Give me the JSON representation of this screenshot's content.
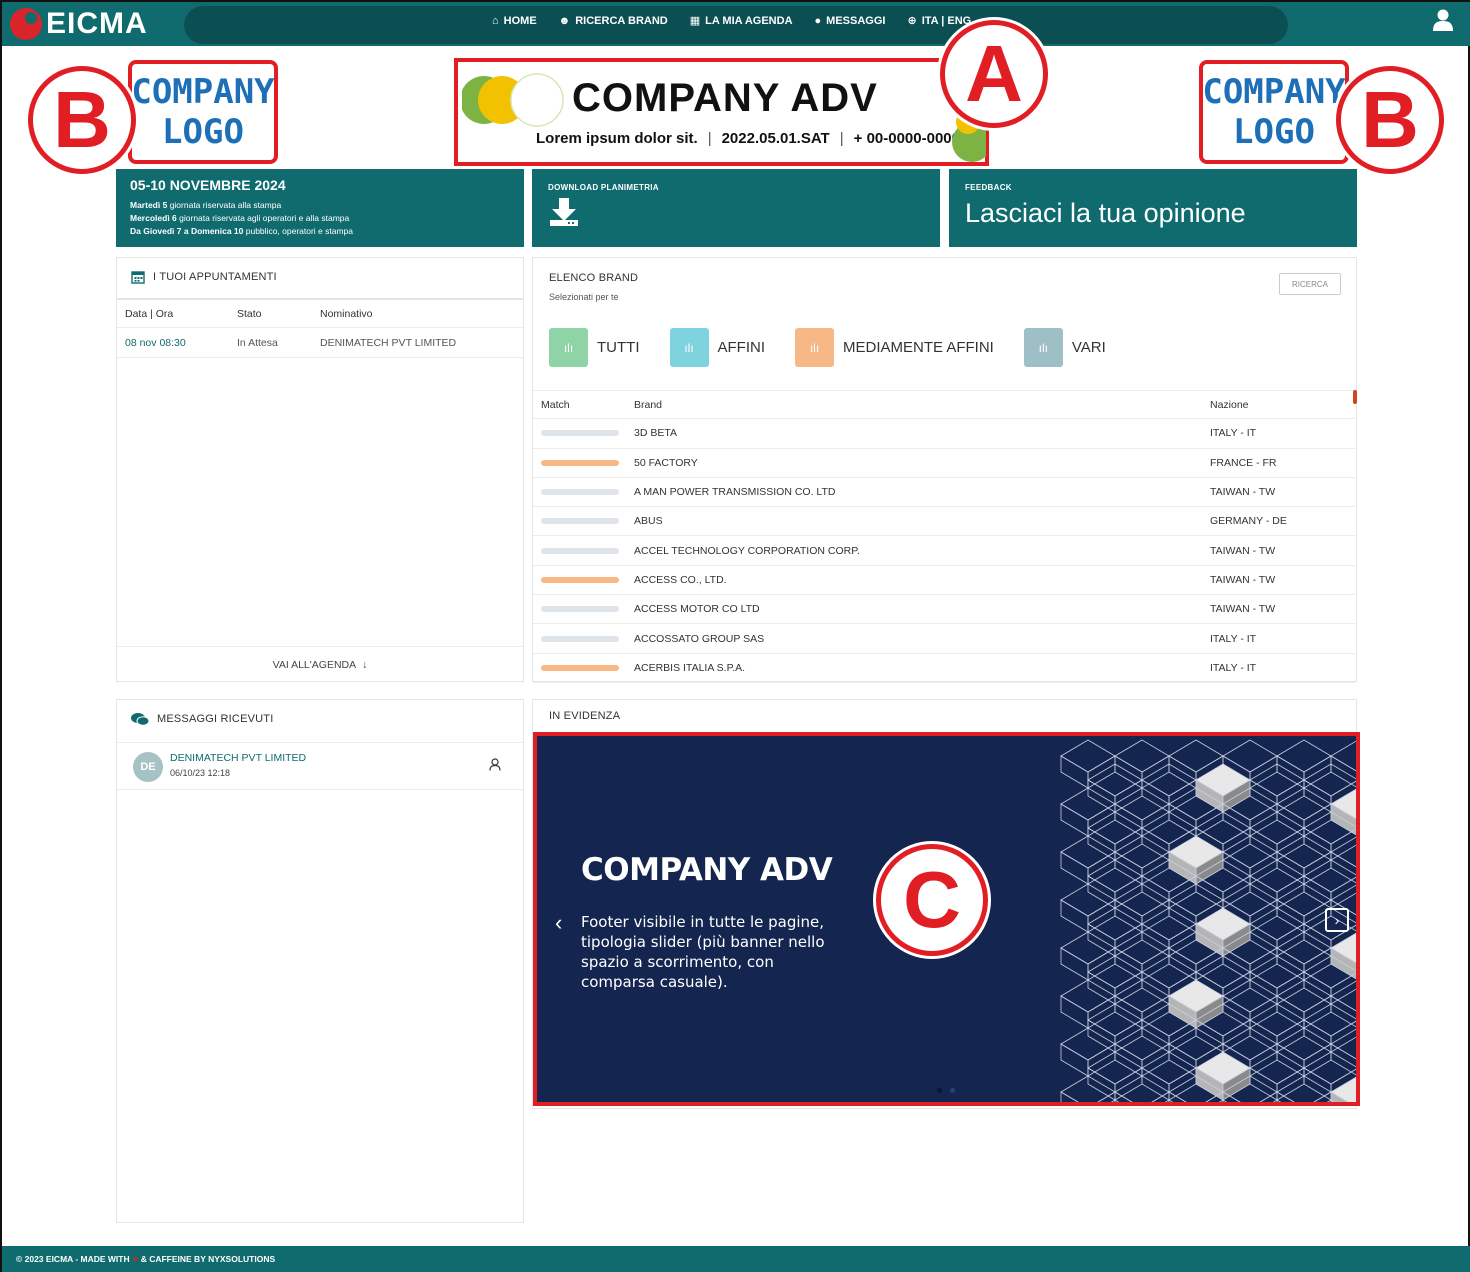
{
  "app": {
    "logo_text": "EICMA"
  },
  "nav": {
    "items": [
      {
        "label": "HOME",
        "icon": "home-icon"
      },
      {
        "label": "RICERCA BRAND",
        "icon": "users-icon"
      },
      {
        "label": "LA MIA AGENDA",
        "icon": "calendar-icon"
      },
      {
        "label": "MESSAGGI",
        "icon": "chat-icon"
      },
      {
        "label": "ITA | ENG",
        "icon": "globe-icon"
      }
    ]
  },
  "ad_top": {
    "title": "COMPANY ADV",
    "subtitle": "Lorem ipsum dolor sit.",
    "date": "2022.05.01.SAT",
    "phone": "+ 00-0000-0000",
    "sep": "|"
  },
  "badges": {
    "a": "A",
    "b": "B",
    "c": "C"
  },
  "company_logo": {
    "line1": "COMPANY",
    "line2": "LOGO"
  },
  "dates_block": {
    "title": "05-10 NOVEMBRE 2024",
    "lines": [
      {
        "bold": "Martedì 5",
        "text": " giornata riservata alla stampa"
      },
      {
        "bold": "Mercoledì 6",
        "text": " giornata  riservata agli operatori e alla stampa"
      },
      {
        "bold": "Da Giovedì 7 a Domenica 10",
        "text": " pubblico, operatori e stampa"
      }
    ]
  },
  "download_block": {
    "caption": "DOWNLOAD PLANIMETRIA"
  },
  "feedback_block": {
    "caption": "FEEDBACK",
    "text": "Lasciaci la tua opinione"
  },
  "appointments": {
    "title": "I TUOI APPUNTAMENTI",
    "headers": [
      "Data | Ora",
      "Stato",
      "Nominativo"
    ],
    "rows": [
      {
        "date": "08 nov 08:30",
        "status": "In Attesa",
        "name": "DENIMATECH PVT LIMITED"
      }
    ],
    "footer": "VAI ALL'AGENDA"
  },
  "brands": {
    "title": "ELENCO BRAND",
    "subtitle": "Selezionati per te",
    "search_label": "RICERCA",
    "filters": [
      {
        "label": "TUTTI",
        "color": "#8fd4a6"
      },
      {
        "label": "AFFINI",
        "color": "#7fd3de"
      },
      {
        "label": "MEDIAMENTE AFFINI",
        "color": "#f6b886"
      },
      {
        "label": "VARI",
        "color": "#9ebfc6"
      }
    ],
    "headers": [
      "Match",
      "Brand",
      "Nazione"
    ],
    "rows": [
      {
        "brand": "3D BETA",
        "country": "ITALY - IT",
        "match_color": "#dfe4ea"
      },
      {
        "brand": "50 FACTORY",
        "country": "FRANCE - FR",
        "match_color": "#f6b886"
      },
      {
        "brand": "A MAN POWER TRANSMISSION CO. LTD",
        "country": "TAIWAN - TW",
        "match_color": "#dfe4ea"
      },
      {
        "brand": "ABUS",
        "country": "GERMANY - DE",
        "match_color": "#dfe4ea"
      },
      {
        "brand": "ACCEL TECHNOLOGY CORPORATION CORP.",
        "country": "TAIWAN - TW",
        "match_color": "#dfe4ea"
      },
      {
        "brand": "ACCESS CO., LTD.",
        "country": "TAIWAN - TW",
        "match_color": "#f6b886"
      },
      {
        "brand": "ACCESS MOTOR CO LTD",
        "country": "TAIWAN - TW",
        "match_color": "#dfe4ea"
      },
      {
        "brand": "ACCOSSATO GROUP SAS",
        "country": "ITALY - IT",
        "match_color": "#dfe4ea"
      },
      {
        "brand": "ACERBIS ITALIA S.P.A.",
        "country": "ITALY - IT",
        "match_color": "#f6b886"
      }
    ]
  },
  "messages": {
    "title": "MESSAGGI RICEVUTI",
    "items": [
      {
        "initials": "DE",
        "sender": "DENIMATECH PVT LIMITED",
        "time": "06/10/23 12:18"
      }
    ]
  },
  "evidenza": {
    "title": "IN EVIDENZA",
    "slide_title": "COMPANY ADV",
    "slide_text": "Footer visibile in tutte le pagine, tipologia slider (più banner nello spazio a scorrimento, con comparsa casuale)."
  },
  "footer": {
    "left": "© 2023 EICMA - MADE WITH",
    "heart": "♥",
    "right": "& CAFFEINE BY NYXSOLUTIONS"
  },
  "colors": {
    "teal": "#0f6b6e",
    "navy": "#14254f",
    "red": "#e01e24"
  }
}
